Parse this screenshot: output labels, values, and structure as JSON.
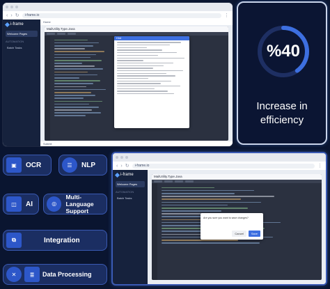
{
  "top_browser": {
    "url": "i-frame.io",
    "brand": "i-frame",
    "sidebar": [
      "Welcome Pages",
      "Batch Tasks"
    ],
    "sidebar_caption": "AUTOMATION",
    "breadcrumb": "Home",
    "file_title": "MailUtility.Type.Java",
    "popup_title": "Hint",
    "footer": "Submit"
  },
  "bottom_browser": {
    "url": "i-frame.io",
    "brand": "i-frame",
    "sidebar": [
      "Welcome Pages",
      "Batch Tasks"
    ],
    "sidebar_caption": "AUTOMATION",
    "file_title": "MailUtility.Type.Java",
    "dialog_text": "Are you sure you want to save changes?",
    "cancel_label": "Cancel",
    "ok_label": "Save"
  },
  "stat": {
    "value": "%40",
    "line1": "Increase in",
    "line2": "efficiency",
    "ring_fraction": 0.4,
    "accent": "#3d6fe0"
  },
  "features": [
    {
      "label": "OCR",
      "icon": "ocr-icon"
    },
    {
      "label": "NLP",
      "icon": "nlp-icon"
    },
    {
      "label": "AI",
      "icon": "ai-chip-icon"
    },
    {
      "label": "Multi-Language Support",
      "icon": "language-icon"
    },
    {
      "label": "Integration",
      "icon": "integration-icon"
    },
    {
      "label": "Data Processing",
      "icon": "database-icon"
    }
  ]
}
